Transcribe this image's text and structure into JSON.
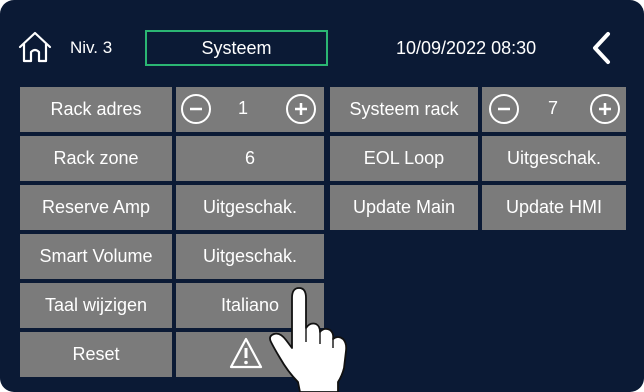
{
  "header": {
    "level": "Niv. 3",
    "title": "Systeem",
    "datetime": "10/09/2022 08:30",
    "home_icon": "home-icon",
    "back_icon": "chevron-left-icon"
  },
  "rows": [
    {
      "label": "Rack adres",
      "value": "1",
      "right_label": "Systeem rack",
      "right_value": "7"
    },
    {
      "label": "Rack zone",
      "value": "6",
      "right_label": "EOL Loop",
      "right_value": "Uitgeschak."
    },
    {
      "label": "Reserve Amp",
      "value": "Uitgeschak.",
      "right_label": "Update Main",
      "right_value": "Update HMI"
    },
    {
      "label": "Smart Volume",
      "value": "Uitgeschak."
    },
    {
      "label": "Taal wijzigen",
      "value": "Italiano"
    },
    {
      "label": "Reset",
      "value_icon": "warning-icon"
    }
  ],
  "colors": {
    "background": "#0b1a35",
    "cell": "#7b7b7b",
    "accent": "#2bb673"
  }
}
